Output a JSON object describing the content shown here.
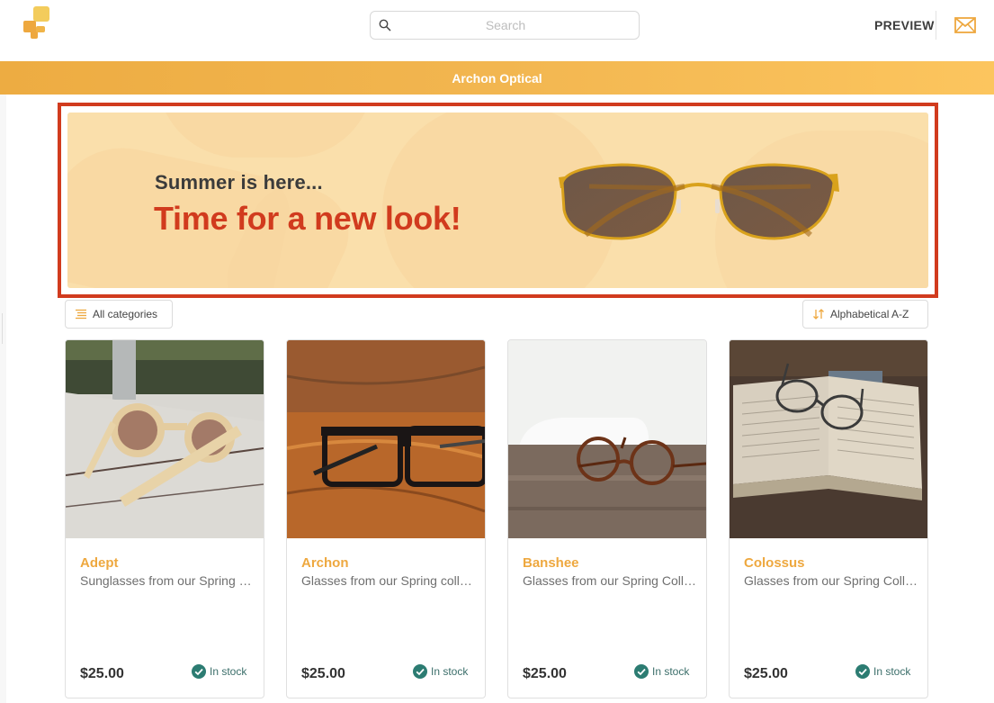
{
  "header": {
    "logo": "app-logo",
    "search_placeholder": "Search",
    "search_value": "",
    "preview_label": "PREVIEW",
    "mail_icon": "envelope-icon"
  },
  "shop": {
    "title": "Archon Optical",
    "accent_color": "#eea83f",
    "highlight_color": "#d13b1e"
  },
  "banner": {
    "subtitle": "Summer is here...",
    "headline": "Time for a new look!",
    "image": "sunglasses-illustration"
  },
  "filters": {
    "category_label": "All categories",
    "category_icon": "list-icon",
    "sort_label": "Alphabetical A-Z",
    "sort_icon": "sort-arrows-icon"
  },
  "products": [
    {
      "name": "Adept",
      "description": "Sunglasses from our Spring collection",
      "price": "$25.00",
      "stock": "In stock",
      "image": "beige-sunglasses-on-dock"
    },
    {
      "name": "Archon",
      "description": "Glasses from our Spring collection",
      "price": "$25.00",
      "stock": "In stock",
      "image": "black-glasses-on-wood"
    },
    {
      "name": "Banshee",
      "description": "Glasses from our Spring Collection",
      "price": "$25.00",
      "stock": "In stock",
      "image": "round-tortoise-glasses-on-table"
    },
    {
      "name": "Colossus",
      "description": "Glasses from our Spring Collection",
      "price": "$25.00",
      "stock": "In stock",
      "image": "glasses-on-open-book"
    }
  ]
}
